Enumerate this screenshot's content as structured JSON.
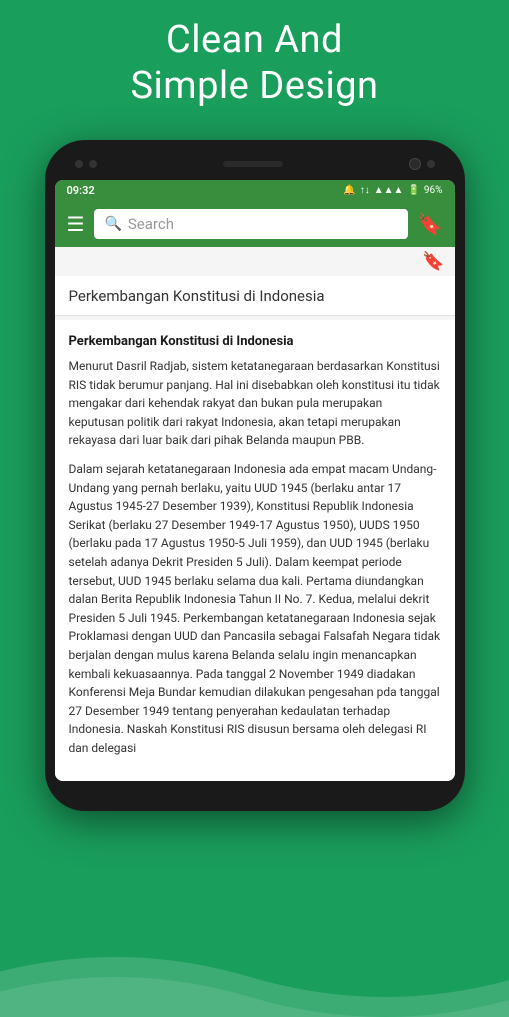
{
  "header": {
    "line1": "Clean And",
    "line2": "Simple Design"
  },
  "phone": {
    "statusBar": {
      "time": "09:32",
      "battery": "96%",
      "icons": "🔔 ↑↓ 📶 🔋"
    },
    "toolbar": {
      "searchPlaceholder": "Search",
      "hamburgerLabel": "≡",
      "bookmarkLabel": "🔖"
    },
    "article": {
      "titleBar": "Perkembangan Konstitusi di Indonesia",
      "bodyTitle": "Perkembangan Konstitusi di Indonesia",
      "paragraph1": "Menurut Dasril Radjab, sistem ketatanegaraan berdasarkan Konstitusi RIS tidak berumur panjang. Hal ini disebabkan oleh konstitusi itu tidak mengakar dari kehendak rakyat dan bukan pula merupakan keputusan politik dari rakyat Indonesia, akan tetapi merupakan rekayasa dari luar baik dari pihak Belanda maupun PBB.",
      "paragraph2": "Dalam sejarah ketatanegaraan Indonesia ada empat macam Undang-Undang yang pernah berlaku, yaitu UUD 1945 (berlaku antar 17 Agustus 1945-27 Desember 1939), Konstitusi Republik Indonesia Serikat (berlaku 27 Desember 1949-17 Agustus 1950), UUDS 1950 (berlaku pada 17 Agustus 1950-5 Juli 1959), dan UUD 1945 (berlaku setelah adanya Dekrit Presiden 5 Juli). Dalam keempat periode tersebut, UUD 1945 berlaku selama dua kali. Pertama diundangkan dalan Berita Republik Indonesia Tahun II No. 7. Kedua, melalui dekrit Presiden 5 Juli 1945. Perkembangan ketatanegaraan Indonesia sejak Proklamasi dengan UUD dan Pancasila sebagai Falsafah Negara tidak berjalan dengan mulus karena Belanda selalu ingin menancapkan kembali kekuasaannya. Pada tanggal 2 November 1949 diadakan Konferensi Meja Bundar kemudian dilakukan pengesahan pda tanggal 27 Desember 1949 tentang penyerahan kedaulatan terhadap Indonesia. Naskah Konstitusi RIS disusun bersama oleh delegasi RI dan delegasi"
    }
  }
}
